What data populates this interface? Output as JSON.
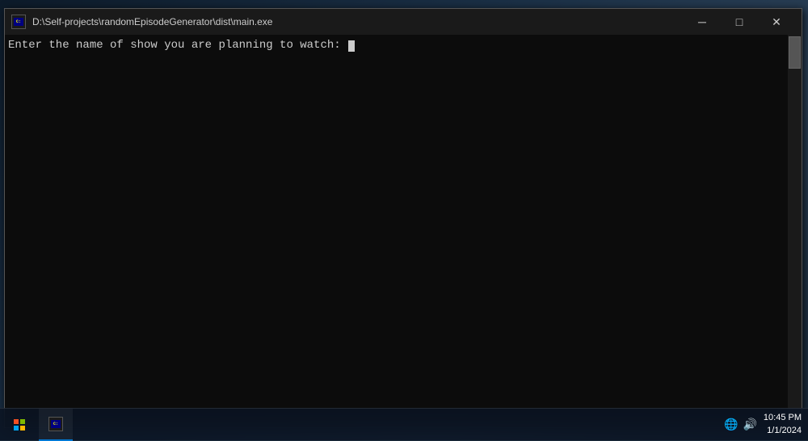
{
  "window": {
    "title": "D:\\Self-projects\\randomEpisodeGenerator\\dist\\main.exe",
    "minimize_label": "─",
    "maximize_label": "□",
    "close_label": "✕"
  },
  "console": {
    "prompt_text": "Enter the name of show you are planning to watch: "
  },
  "taskbar": {
    "time": "...",
    "date": "..."
  }
}
